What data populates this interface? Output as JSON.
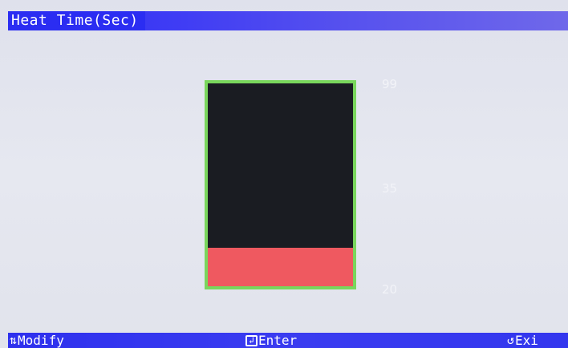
{
  "header": {
    "title": "Heat Time(Sec)"
  },
  "gauge": {
    "max_label": "99",
    "current_label": "35",
    "min_label": "20",
    "max": 99,
    "min": 20,
    "value": 35,
    "colors": {
      "frame": "#79d65c",
      "empty": "#1a1c22",
      "fill": "#ef5960"
    }
  },
  "footer": {
    "modify_icon": "up-down-arrows-icon",
    "modify_label": "Modify",
    "enter_icon": "enter-icon",
    "enter_label": "Enter",
    "exit_icon": "undo-arrow-icon",
    "exit_label": "Exi"
  }
}
